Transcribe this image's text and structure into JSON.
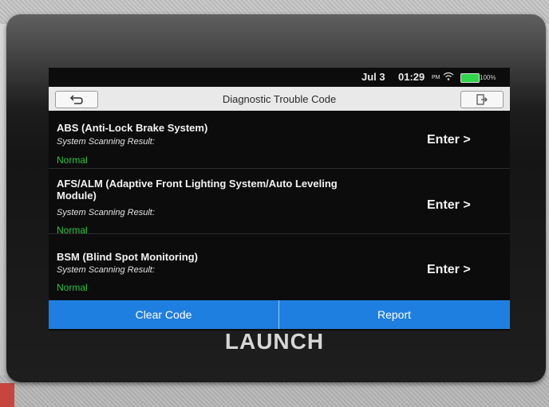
{
  "status": {
    "date": "Jul 3",
    "time": "01:29",
    "ampm": "PM",
    "battery": "100%"
  },
  "header": {
    "title": "Diagnostic Trouble Code"
  },
  "systems": [
    {
      "name": "ABS (Anti-Lock Brake System)",
      "sub": "System Scanning Result:",
      "status": "Normal",
      "action": "Enter >"
    },
    {
      "name": "AFS/ALM (Adaptive Front Lighting System/Auto Leveling Module)",
      "sub": "System Scanning Result:",
      "status": "Normal",
      "action": "Enter >"
    },
    {
      "name": "BSM (Blind Spot Monitoring)",
      "sub": "System Scanning Result:",
      "status": "Normal",
      "action": "Enter >"
    }
  ],
  "footer": {
    "clear_label": "Clear Code",
    "report_label": "Report"
  },
  "device": {
    "brand": "LAUNCH"
  },
  "colors": {
    "accent": "#1f7fe0",
    "status_ok": "#27c441",
    "battery": "#2fd64a"
  },
  "icons": {
    "back": "back-arrow-icon",
    "exit": "exit-icon",
    "wifi": "wifi-icon",
    "battery": "battery-icon"
  }
}
